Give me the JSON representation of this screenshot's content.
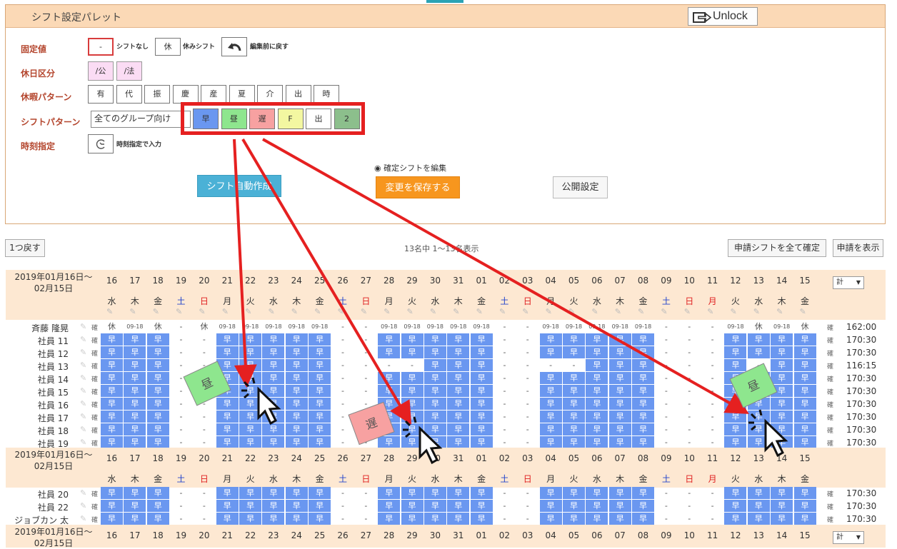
{
  "palette": {
    "title": "シフト設定パレット",
    "unlock_label": "Unlock",
    "fixed_label": "固定値",
    "fixed_none_symbol": "-",
    "fixed_none_text": "シフトなし",
    "fixed_rest_symbol": "休",
    "fixed_rest_text": "休みシフト",
    "fixed_undo_text": "編集前に戻す",
    "holiday_label": "休日区分",
    "holiday_items": [
      "/公",
      "/法"
    ],
    "leave_label": "休暇パターン",
    "leave_items": [
      "有",
      "代",
      "振",
      "慶",
      "産",
      "夏",
      "介",
      "出",
      "時"
    ],
    "shift_label": "シフトパターン",
    "shift_group_select": "全てのグループ向け",
    "shift_items": [
      {
        "label": "早",
        "color": "#6a97f0"
      },
      {
        "label": "昼",
        "color": "#8ee68e"
      },
      {
        "label": "遅",
        "color": "#f7a1a1"
      },
      {
        "label": "F",
        "color": "#f3f7a1"
      },
      {
        "label": "出",
        "color": "#ffffff"
      },
      {
        "label": "2",
        "color": "#8cbf8c"
      }
    ],
    "time_label": "時刻指定",
    "time_text": "時刻指定で入力",
    "radio_label": "確定シフトを編集",
    "auto_button": "シフト自動作成",
    "save_button": "変更を保存する",
    "publish_button": "公開設定"
  },
  "toolbar": {
    "undo": "1つ戻す",
    "count": "13名中 1〜13名表示",
    "confirm_all": "申請シフトを全て確定",
    "show_requests": "申請を表示"
  },
  "table": {
    "period": "2019年01月16日〜",
    "period2": "02月15日",
    "total_select": "計",
    "dates": [
      "16",
      "17",
      "18",
      "19",
      "20",
      "21",
      "22",
      "23",
      "24",
      "25",
      "26",
      "27",
      "28",
      "29",
      "30",
      "31",
      "01",
      "02",
      "03",
      "04",
      "05",
      "06",
      "07",
      "08",
      "09",
      "10",
      "11",
      "12",
      "13",
      "14",
      "15"
    ],
    "weekdays": [
      "水",
      "木",
      "金",
      "土",
      "日",
      "月",
      "火",
      "水",
      "木",
      "金",
      "土",
      "日",
      "月",
      "火",
      "水",
      "木",
      "金",
      "土",
      "日",
      "月",
      "火",
      "水",
      "木",
      "金",
      "土",
      "日",
      "月",
      "火",
      "水",
      "木",
      "金"
    ],
    "confirm_mark": "確",
    "rows": [
      {
        "name": "斉藤 隆晃",
        "total": "162:00",
        "cells": [
          "休",
          "09-18",
          "休",
          "-",
          "休",
          "09-18",
          "09-18",
          "09-18",
          "09-18",
          "09-18",
          "-",
          "-",
          "09-18",
          "09-18",
          "09-18",
          "09-18",
          "09-18",
          "-",
          "-",
          "09-18",
          "09-18",
          "09-18",
          "09-18",
          "09-18",
          "-",
          "-",
          "-",
          "09-18",
          "休",
          "09-18",
          "休"
        ]
      },
      {
        "name": "社員 11",
        "total": "170:30",
        "cells": [
          "早",
          "早",
          "早",
          "-",
          "-",
          "早",
          "早",
          "早",
          "早",
          "早",
          "-",
          "-",
          "早",
          "早",
          "早",
          "早",
          "早",
          "-",
          "-",
          "早",
          "早",
          "早",
          "早",
          "早",
          "-",
          "-",
          "-",
          "早",
          "早",
          "早",
          "早"
        ]
      },
      {
        "name": "社員 12",
        "total": "170:30",
        "cells": [
          "早",
          "早",
          "早",
          "-",
          "-",
          "早",
          "早",
          "早",
          "早",
          "早",
          "-",
          "-",
          "早",
          "早",
          "早",
          "早",
          "早",
          "-",
          "-",
          "早",
          "早",
          "早",
          "早",
          "早",
          "-",
          "-",
          "-",
          "早",
          "早",
          "早",
          "早"
        ]
      },
      {
        "name": "社員 13",
        "total": "116:15",
        "cells": [
          "早",
          "早",
          "早",
          "-",
          "-",
          "早",
          "早",
          "早",
          "早",
          "早",
          "-",
          "-",
          "-",
          "-",
          "早",
          "早",
          "早",
          "-",
          "-",
          "-",
          "-",
          "早",
          "早",
          "早",
          "-",
          "-",
          "-",
          "早",
          "-",
          "早",
          "早"
        ]
      },
      {
        "name": "社員 14",
        "total": "170:30",
        "cells": [
          "早",
          "早",
          "早",
          "-",
          "-",
          "早",
          "早",
          "早",
          "早",
          "早",
          "-",
          "-",
          "早",
          "早",
          "早",
          "早",
          "早",
          "-",
          "-",
          "早",
          "早",
          "早",
          "早",
          "早",
          "-",
          "-",
          "-",
          "早",
          "早",
          "早",
          "早"
        ]
      },
      {
        "name": "社員 15",
        "total": "170:30",
        "cells": [
          "早",
          "早",
          "早",
          "-",
          "-",
          "早",
          "早",
          "早",
          "早",
          "早",
          "-",
          "-",
          "早",
          "早",
          "早",
          "早",
          "早",
          "-",
          "-",
          "早",
          "早",
          "早",
          "早",
          "早",
          "-",
          "-",
          "-",
          "早",
          "早",
          "早",
          "早"
        ]
      },
      {
        "name": "社員 16",
        "total": "170:30",
        "cells": [
          "早",
          "早",
          "早",
          "-",
          "-",
          "早",
          "早",
          "早",
          "早",
          "早",
          "-",
          "-",
          "早",
          "早",
          "早",
          "早",
          "早",
          "-",
          "-",
          "早",
          "早",
          "早",
          "早",
          "早",
          "-",
          "-",
          "-",
          "早",
          "早",
          "早",
          "早"
        ]
      },
      {
        "name": "社員 17",
        "total": "170:30",
        "cells": [
          "早",
          "早",
          "早",
          "-",
          "-",
          "早",
          "早",
          "早",
          "早",
          "早",
          "-",
          "-",
          "早",
          "早",
          "早",
          "早",
          "早",
          "-",
          "-",
          "早",
          "早",
          "早",
          "早",
          "早",
          "-",
          "-",
          "-",
          "早",
          "早",
          "早",
          "早"
        ]
      },
      {
        "name": "社員 18",
        "total": "170:30",
        "cells": [
          "早",
          "早",
          "早",
          "-",
          "-",
          "早",
          "早",
          "早",
          "早",
          "早",
          "-",
          "-",
          "早",
          "早",
          "早",
          "早",
          "早",
          "-",
          "-",
          "早",
          "早",
          "早",
          "早",
          "早",
          "-",
          "-",
          "-",
          "早",
          "早",
          "早",
          "早"
        ]
      },
      {
        "name": "社員 19",
        "total": "170:30",
        "cells": [
          "早",
          "早",
          "早",
          "-",
          "-",
          "早",
          "早",
          "早",
          "早",
          "早",
          "-",
          "-",
          "早",
          "早",
          "早",
          "早",
          "早",
          "-",
          "-",
          "早",
          "早",
          "早",
          "早",
          "早",
          "-",
          "-",
          "-",
          "早",
          "早",
          "早",
          "早"
        ]
      }
    ],
    "rows2": [
      {
        "name": "社員 20",
        "total": "170:30"
      },
      {
        "name": "社員 22",
        "total": "170:30"
      },
      {
        "name": "ジョブカン 太郎",
        "total": "170:30"
      }
    ]
  },
  "overlay": {
    "tiles": [
      {
        "label": "昼",
        "color": "#8ee68e"
      },
      {
        "label": "遅",
        "color": "#f7a1a1"
      },
      {
        "label": "昼",
        "color": "#8ee68e"
      }
    ],
    "arrow_color": "#e52020"
  }
}
